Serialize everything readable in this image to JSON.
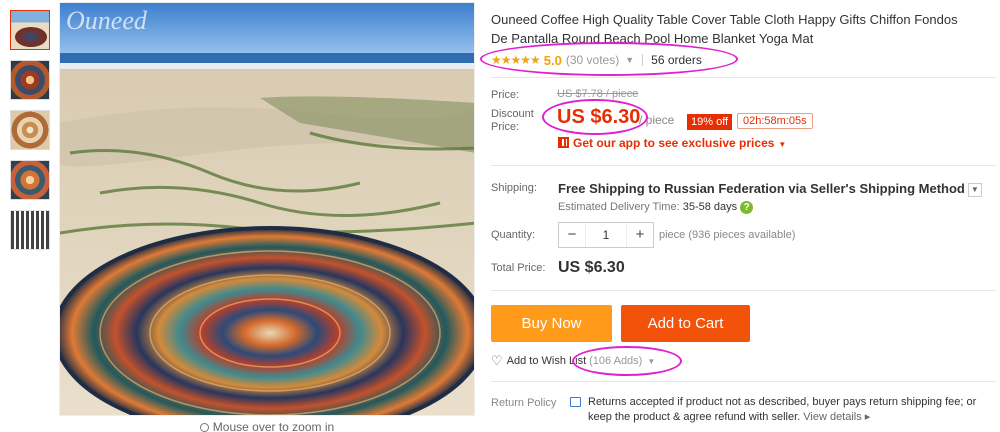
{
  "product": {
    "title": "Ouneed Coffee High Quality Table Cover Table Cloth Happy Gifts Chiffon Fondos De Pantalla Round Beach Pool Home Blanket Yoga Mat",
    "watermark": "Ouneed",
    "zoom_hint": "Mouse over to zoom in"
  },
  "rating": {
    "stars": "★★★★★",
    "score": "5.0",
    "votes": "(30 votes)",
    "orders": "56 orders",
    "stars_value": 5
  },
  "price": {
    "label": "Price:",
    "original": "US $7.78 / piece",
    "discount_label_1": "Discount",
    "discount_label_2": "Price:",
    "discount": "US $6.30",
    "unit": "/ piece",
    "off_badge": "19% off",
    "timer": "02h:58m:05s",
    "app_promo": "Get our app to see exclusive prices"
  },
  "shipping": {
    "label": "Shipping:",
    "free_text": "Free Shipping",
    "to_text": " to Russian Federation via Seller's Shipping Method",
    "est_label": "Estimated Delivery Time: ",
    "est_value": "35-58 days",
    "help": "?"
  },
  "quantity": {
    "label": "Quantity:",
    "minus": "−",
    "value": "1",
    "plus": "+",
    "available": "piece (936 pieces available)"
  },
  "total": {
    "label": "Total Price:",
    "value": "US $6.30"
  },
  "actions": {
    "buy_now": "Buy Now",
    "add_to_cart": "Add to Cart",
    "wishlist": "Add to Wish List",
    "wishlist_adds": "(106 Adds)"
  },
  "return_policy": {
    "label": "Return Policy",
    "text": "Returns accepted if product not as described, buyer pays return shipping fee; or keep the product & agree refund with seller.",
    "link": "View details ▸"
  },
  "colors": {
    "accent": "#e62e04",
    "buy_now": "#ff9a1a",
    "add_to_cart": "#f2520a",
    "star": "#f2a30a",
    "annotation_ring": "#e11ed0"
  }
}
